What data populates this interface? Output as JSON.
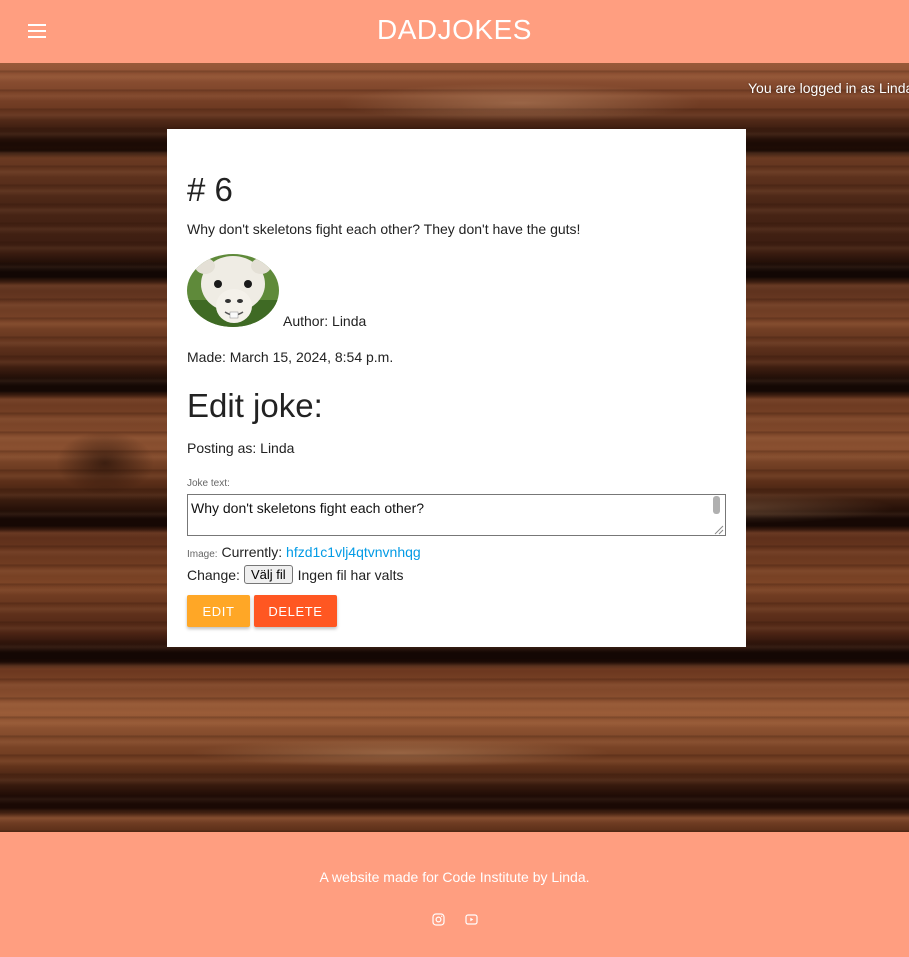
{
  "navbar": {
    "brand": "DADJOKES",
    "menu_icon": "menu-icon"
  },
  "login_status": "You are logged in as Linda",
  "joke": {
    "number_heading": "# 6",
    "text": "Why don't skeletons fight each other? They don't have the guts!",
    "author_label": "Author: Linda",
    "made_label": "Made: March 15, 2024, 8:54 p.m."
  },
  "edit_form": {
    "title": "Edit joke:",
    "posting_as": "Posting as: Linda",
    "joke_text_label": "Joke text:",
    "joke_text_value": "Why don't skeletons fight each other?\n\nThey don't have the guts!",
    "image_label": "Image:",
    "image_currently_label": "Currently:",
    "image_current_value": "hfzd1c1vlj4qtvnvnhqg",
    "change_label": "Change:",
    "file_button_label": "Välj fil",
    "file_status": "Ingen fil har valts",
    "edit_button": "EDIT",
    "delete_button": "DELETE"
  },
  "footer": {
    "text": "A website made for Code Institute by Linda.",
    "icons": [
      "instagram-icon",
      "youtube-icon"
    ]
  },
  "colors": {
    "brand": "#ff9e80",
    "edit_button": "#ffa726",
    "delete_button": "#ff5722",
    "link": "#039be5"
  }
}
